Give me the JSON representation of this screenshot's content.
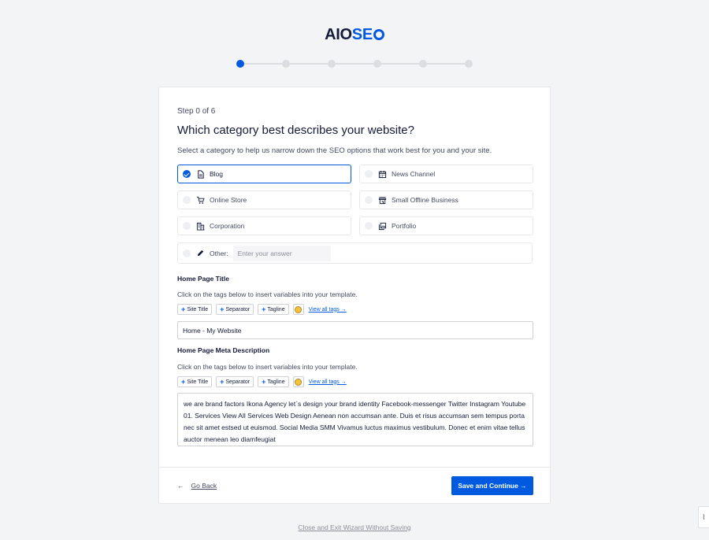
{
  "logo": {
    "part1": "AIO",
    "part2": "SE"
  },
  "wizard": {
    "step_label": "Step 0 of 6",
    "title": "Which category best describes your website?",
    "subtitle": "Select a category to help us narrow down the SEO options that work best for you and your site.",
    "categories": [
      {
        "label": "Blog",
        "icon": "document-icon",
        "selected": true
      },
      {
        "label": "News Channel",
        "icon": "calendar-icon",
        "selected": false
      },
      {
        "label": "Online Store",
        "icon": "cart-icon",
        "selected": false
      },
      {
        "label": "Small Offline Business",
        "icon": "storefront-icon",
        "selected": false
      },
      {
        "label": "Corporation",
        "icon": "building-icon",
        "selected": false
      },
      {
        "label": "Portfolio",
        "icon": "gallery-icon",
        "selected": false
      }
    ],
    "other": {
      "label": "Other:",
      "placeholder": "Enter your answer",
      "icon": "pencil-icon"
    }
  },
  "home_title": {
    "label": "Home Page Title",
    "hint": "Click on the tags below to insert variables into your template.",
    "tags": [
      "Site Title",
      "Separator",
      "Tagline"
    ],
    "view_all": "View all tags →",
    "value": "Home - My Website"
  },
  "home_desc": {
    "label": "Home Page Meta Description",
    "hint": "Click on the tags below to insert variables into your template.",
    "tags": [
      "Site Title",
      "Separator",
      "Tagline"
    ],
    "view_all": "View all tags →",
    "value": "we are brand factors Ikona Agency let`s design your brand identity Facebook-messenger Twitter Instagram Youtube 01. Services View All Services Web Design Aenean non accumsan ante. Duis et risus accumsan sem tempus porta nec sit amet estsed ut euismod. Social Media SMM Vivamus luctus maximus vestibulum. Donec et enim vitae tellus auctor menean leo diamfeugiat"
  },
  "footer": {
    "go_back": "Go Back",
    "save": "Save and Continue →",
    "exit": "Close and Exit Wizard Without Saving"
  },
  "colors": {
    "accent": "#005ae0",
    "text": "#141b38",
    "muted": "#434960"
  }
}
